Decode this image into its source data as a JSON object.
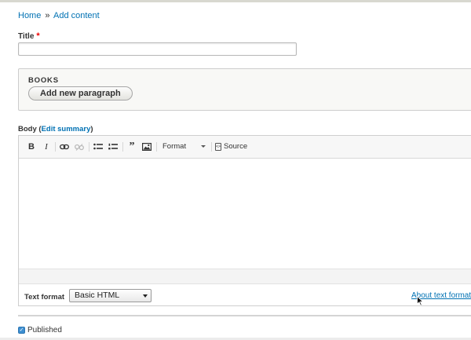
{
  "breadcrumb": {
    "home": "Home",
    "separator": "»",
    "current": "Add content"
  },
  "title_field": {
    "label": "Title",
    "required_marker": "*",
    "value": ""
  },
  "books": {
    "label": "BOOKS",
    "add_button": "Add new paragraph"
  },
  "body_field": {
    "label": "Body",
    "open_paren": "(",
    "edit_summary": "Edit summary",
    "close_paren": ")"
  },
  "toolbar": {
    "bold": "B",
    "italic": "I",
    "format_label": "Format",
    "source_label": "Source"
  },
  "text_format": {
    "label": "Text format",
    "selected": "Basic HTML",
    "about_link": "About text formats"
  },
  "published": {
    "label": "Published",
    "checked": true
  },
  "colors": {
    "link": "#0071b3",
    "required": "#e00000",
    "checkbox": "#3d8fd1"
  }
}
